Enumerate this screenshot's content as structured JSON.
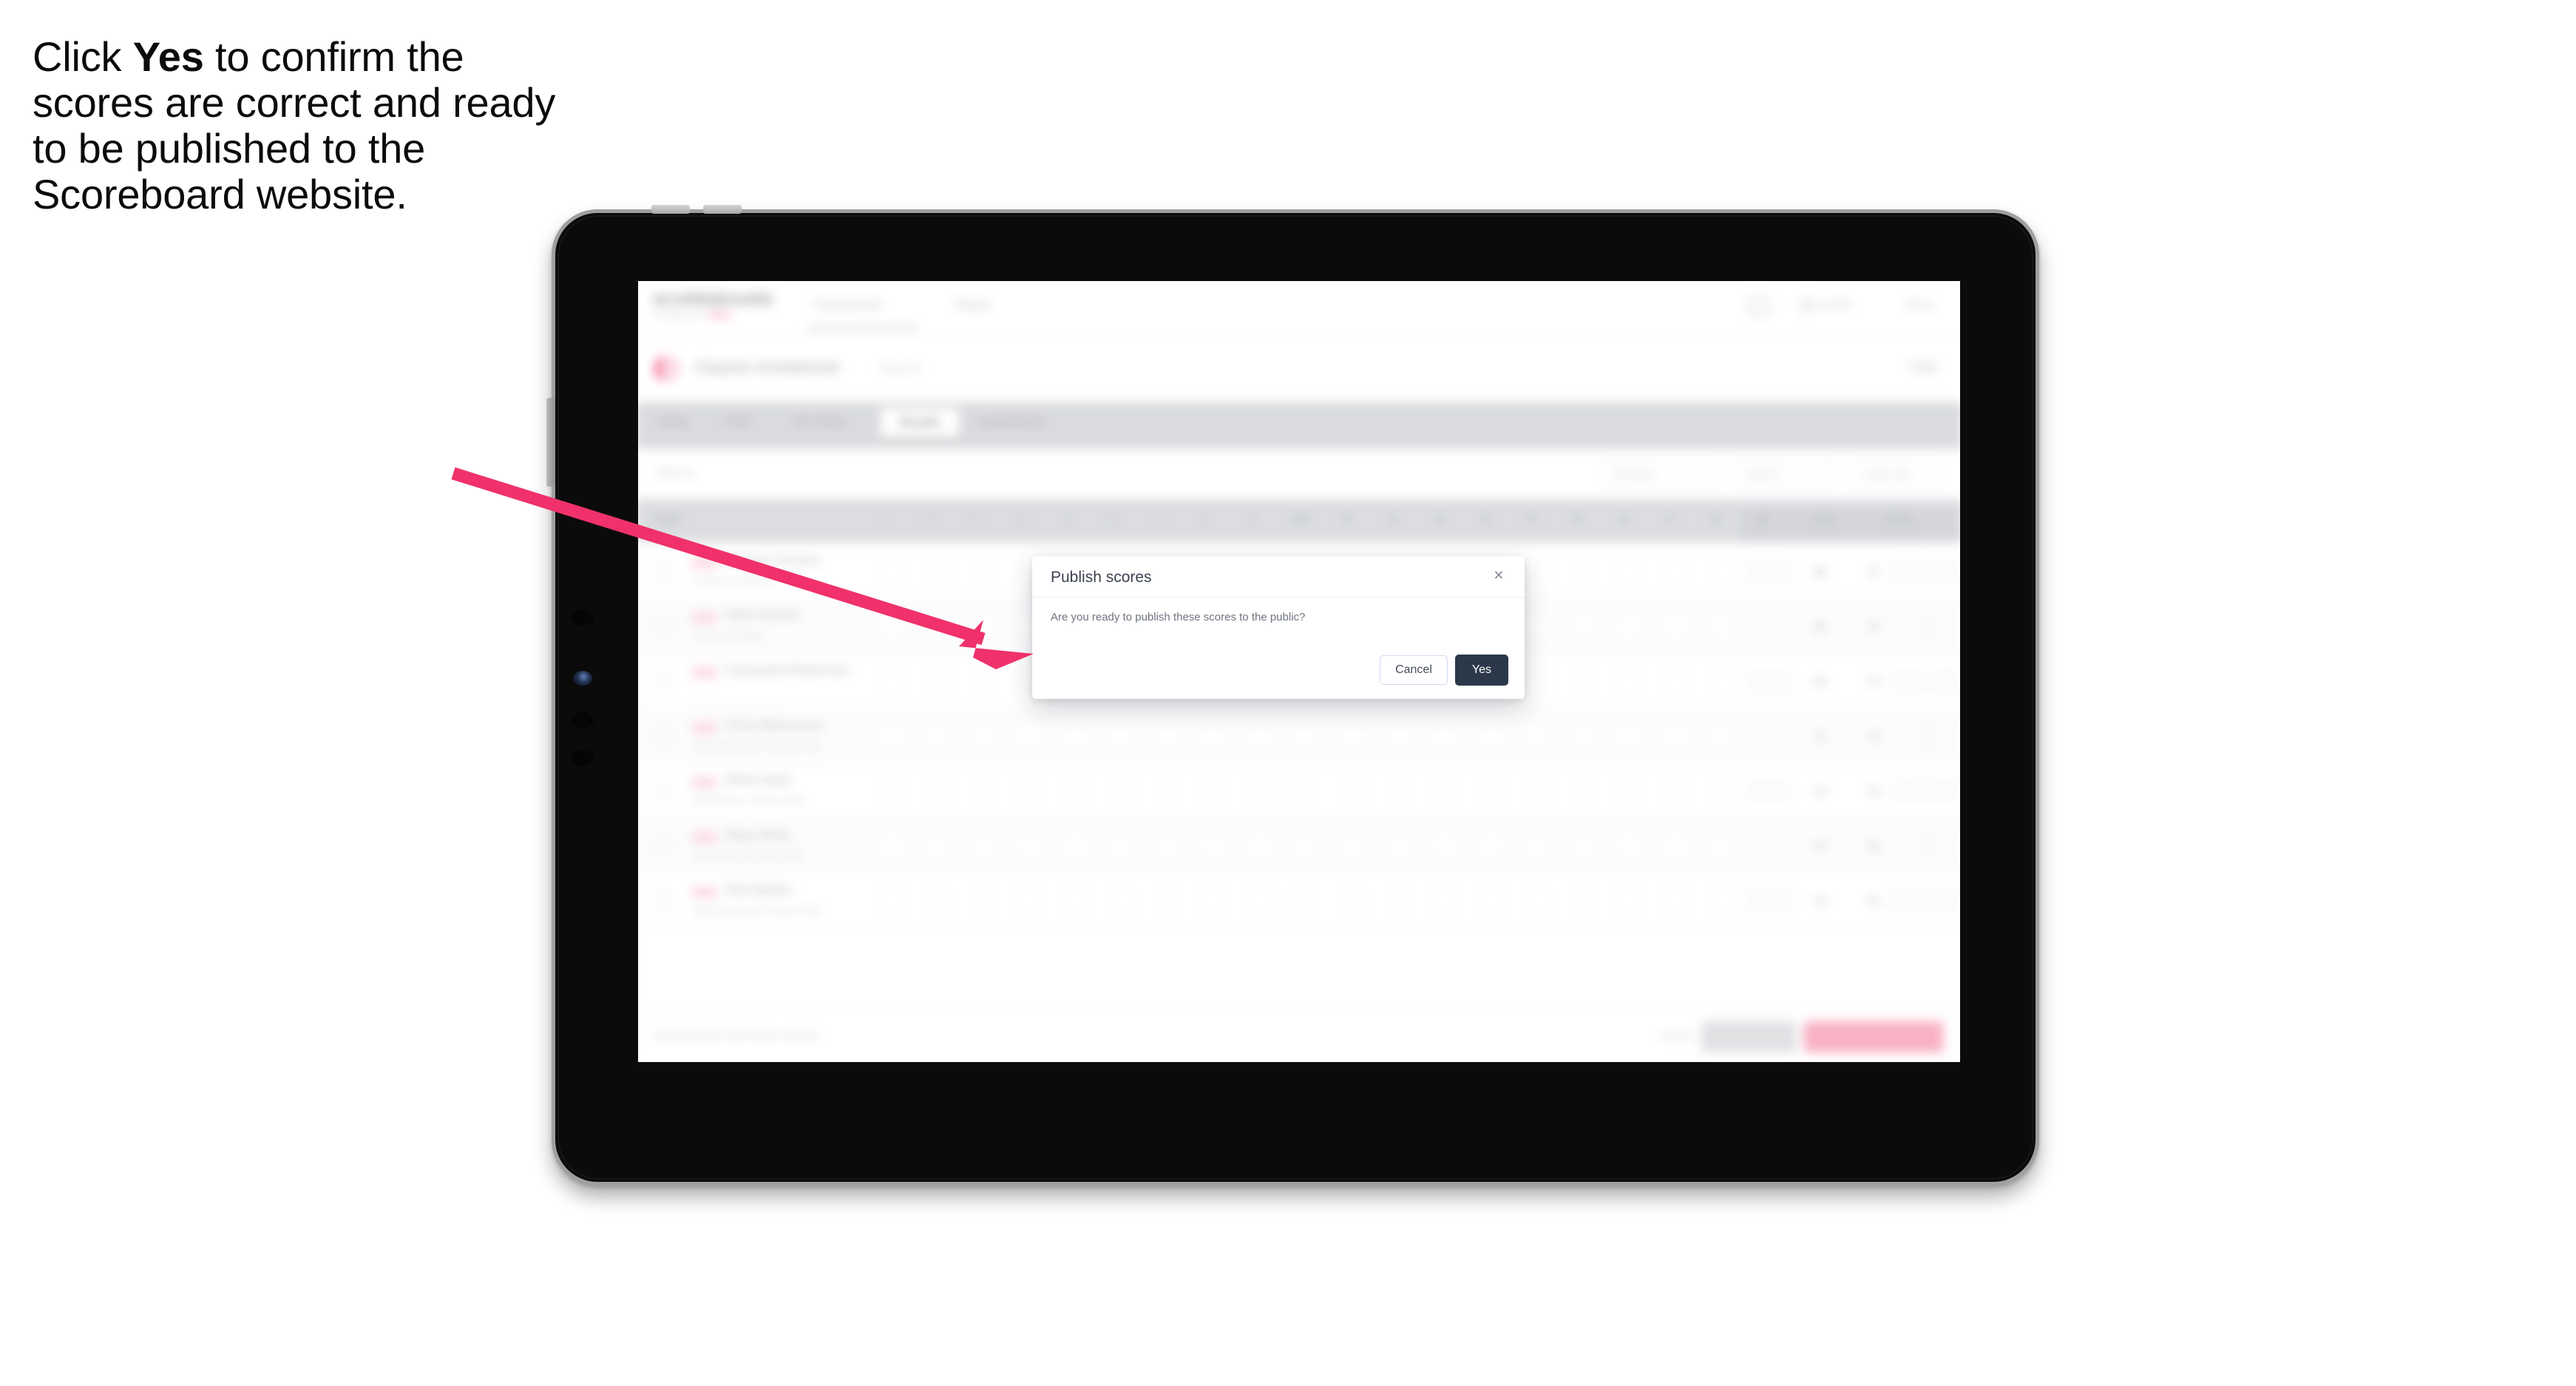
{
  "caption": {
    "before": "Click ",
    "bold": "Yes",
    "after": " to confirm the scores are correct and ready to be published to the Scoreboard website."
  },
  "colors": {
    "arrow_pink": "#F0316B",
    "primary_dark": "#2B3849",
    "cancel_border": "#CFDCEF",
    "brand_pink": "#F2396F",
    "bezel_silver": "#9FA0A2",
    "screen_black": "#0B0B0B"
  },
  "device": {
    "type": "tablet",
    "orientation": "landscape",
    "hardware_buttons": [
      "volume-up",
      "volume-down",
      "power"
    ]
  },
  "modal": {
    "title": "Publish scores",
    "message": "Are you ready to publish these scores to the public?",
    "close_label": "×",
    "cancel_label": "Cancel",
    "confirm_label": "Yes"
  },
  "app": {
    "brand": {
      "word": "SCOREBOARD",
      "sub": "POWERED BY",
      "sub_accent": "GOLF"
    },
    "nav": [
      {
        "label": "Tournaments"
      },
      {
        "label": "Teams"
      }
    ],
    "header_right": {
      "user": "Bob Smith",
      "menu": "Menu"
    },
    "tournament": {
      "name": "Clayton Invitational",
      "sub": "Round 1",
      "status": "Live"
    },
    "tabs": [
      {
        "label": "Setup",
        "active": false
      },
      {
        "label": "Field",
        "active": false
      },
      {
        "label": "Tee Times",
        "active": false
      },
      {
        "label": "Results",
        "active": true
      },
      {
        "label": "Leaderboard",
        "active": false
      }
    ],
    "filters": {
      "label": "Filter by",
      "pills": [
        "All rounds",
        "Round 1",
        "Gross only"
      ]
    },
    "table": {
      "columns": [
        "Player",
        "1",
        "2",
        "3",
        "4",
        "5",
        "6",
        "7",
        "8",
        "9",
        "OUT",
        "10",
        "11",
        "12",
        "13",
        "14",
        "15",
        "16",
        "17",
        "18",
        "IN",
        "Total",
        "Gross",
        "Net"
      ],
      "rows": [
        {
          "rank": "1st",
          "name": "Malcolm Torrens",
          "sub": "Clayton Invitational",
          "total": "68",
          "hcp": "72",
          "gross": "",
          "net": ""
        },
        {
          "rank": "2nd",
          "name": "Ellen Parnell",
          "sub": "Stewart's Bridge",
          "total": "69",
          "hcp": "73",
          "gross": "",
          "net": ""
        },
        {
          "rank": "3rd",
          "name": "Cassandra Robertson",
          "sub": "",
          "total": "69",
          "hcp": "74",
          "gross": "",
          "net": ""
        },
        {
          "rank": "4th",
          "name": "Chris Weaverson",
          "sub": "West Brunswick Country Club",
          "total": "71",
          "hcp": "74",
          "gross": "",
          "net": ""
        },
        {
          "rank": "5th",
          "name": "Dillon Nash",
          "sub": "Brookhaven Country Club",
          "total": "72",
          "hcp": "75",
          "gross": "",
          "net": ""
        },
        {
          "rank": "6th",
          "name": "Maya Wells",
          "sub": "Brookhaven Country Club",
          "total": "72",
          "hcp": "76",
          "gross": "",
          "net": ""
        },
        {
          "rank": "7th",
          "name": "Nick Barker",
          "sub": "West Brunswick Country Club",
          "total": "74",
          "hcp": "76",
          "gross": "",
          "net": ""
        }
      ]
    },
    "footer": {
      "note": "Not all scores have been entered",
      "link": "Cancel",
      "secondary_button": "Save draft",
      "primary_button": "Publish to Scoreboard"
    }
  }
}
